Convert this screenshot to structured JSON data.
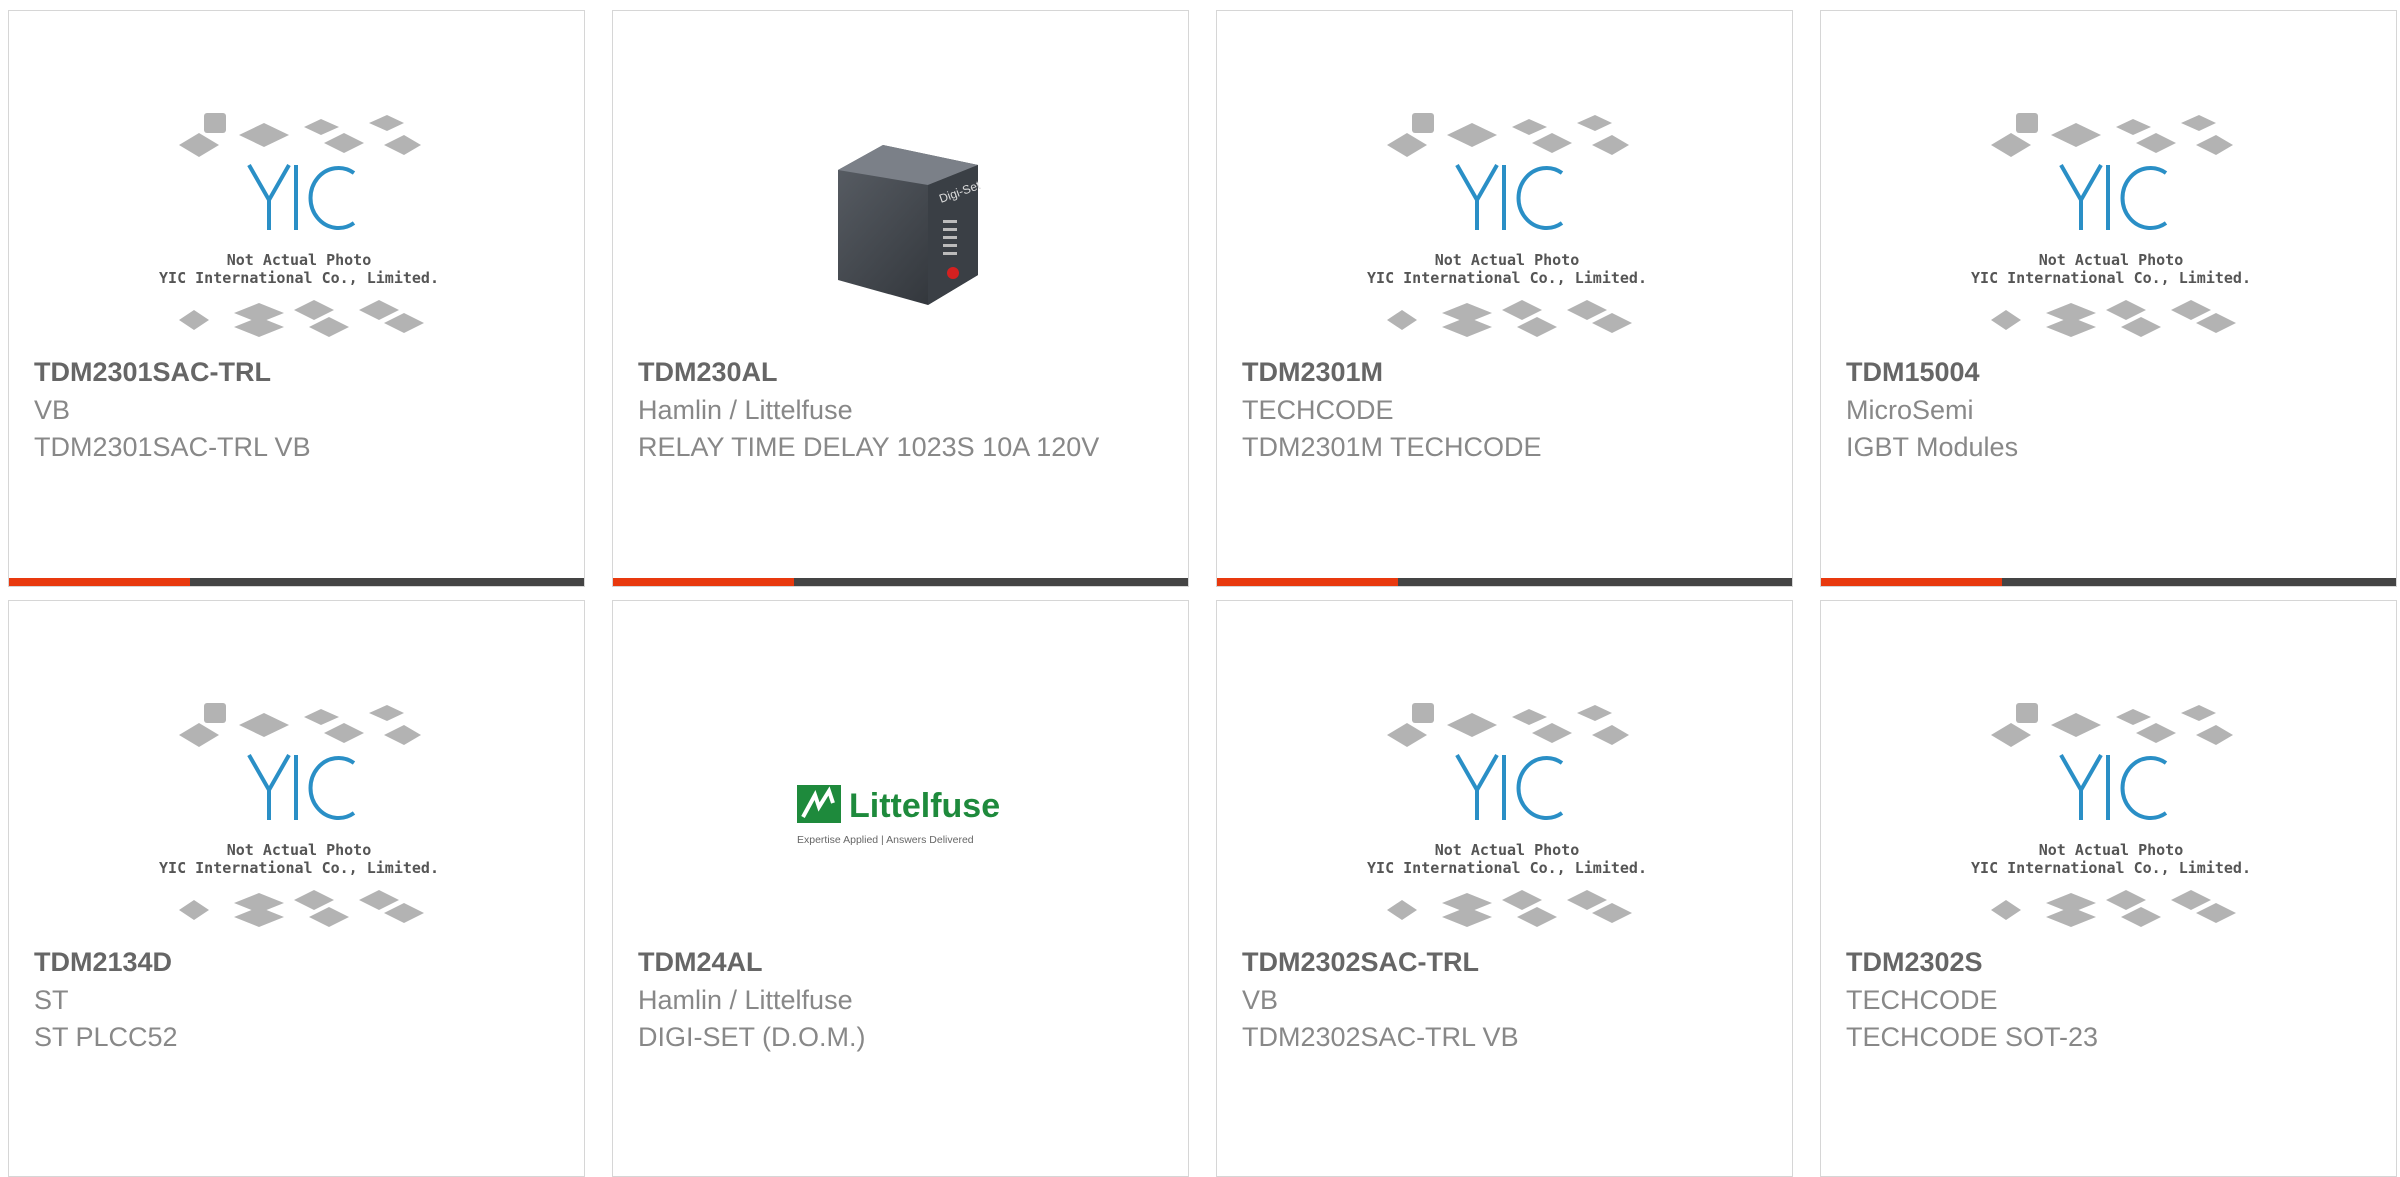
{
  "colors": {
    "accent": "#e8390e",
    "dark": "#444444",
    "border": "#d6d6d6",
    "yic_blue": "#2a8fc6"
  },
  "placeholder": {
    "line1": "Not Actual Photo",
    "line2": "YIC International Co., Limited.",
    "logo": "YIC"
  },
  "products": [
    {
      "part": "TDM2301SAC-TRL",
      "manufacturer": "VB",
      "description": "TDM2301SAC-TRL VB",
      "image": "placeholder"
    },
    {
      "part": "TDM230AL",
      "manufacturer": "Hamlin / Littelfuse",
      "description": "RELAY TIME DELAY 1023S 10A 120V",
      "image": "relay-photo"
    },
    {
      "part": "TDM2301M",
      "manufacturer": "TECHCODE",
      "description": "TDM2301M TECHCODE",
      "image": "placeholder"
    },
    {
      "part": "TDM15004",
      "manufacturer": "MicroSemi",
      "description": "IGBT Modules",
      "image": "placeholder"
    },
    {
      "part": "TDM2134D",
      "manufacturer": "ST",
      "description": "ST PLCC52",
      "image": "placeholder"
    },
    {
      "part": "TDM24AL",
      "manufacturer": "Hamlin / Littelfuse",
      "description": "DIGI-SET (D.O.M.)",
      "image": "littelfuse-logo"
    },
    {
      "part": "TDM2302SAC-TRL",
      "manufacturer": "VB",
      "description": "TDM2302SAC-TRL VB",
      "image": "placeholder"
    },
    {
      "part": "TDM2302S",
      "manufacturer": "TECHCODE",
      "description": "TECHCODE SOT-23",
      "image": "placeholder"
    }
  ],
  "relay_photo": {
    "brand": "Digi-Set"
  },
  "littelfuse_logo": {
    "wordmark": "Littelfuse",
    "tagline": "Expertise Applied | Answers Delivered"
  }
}
